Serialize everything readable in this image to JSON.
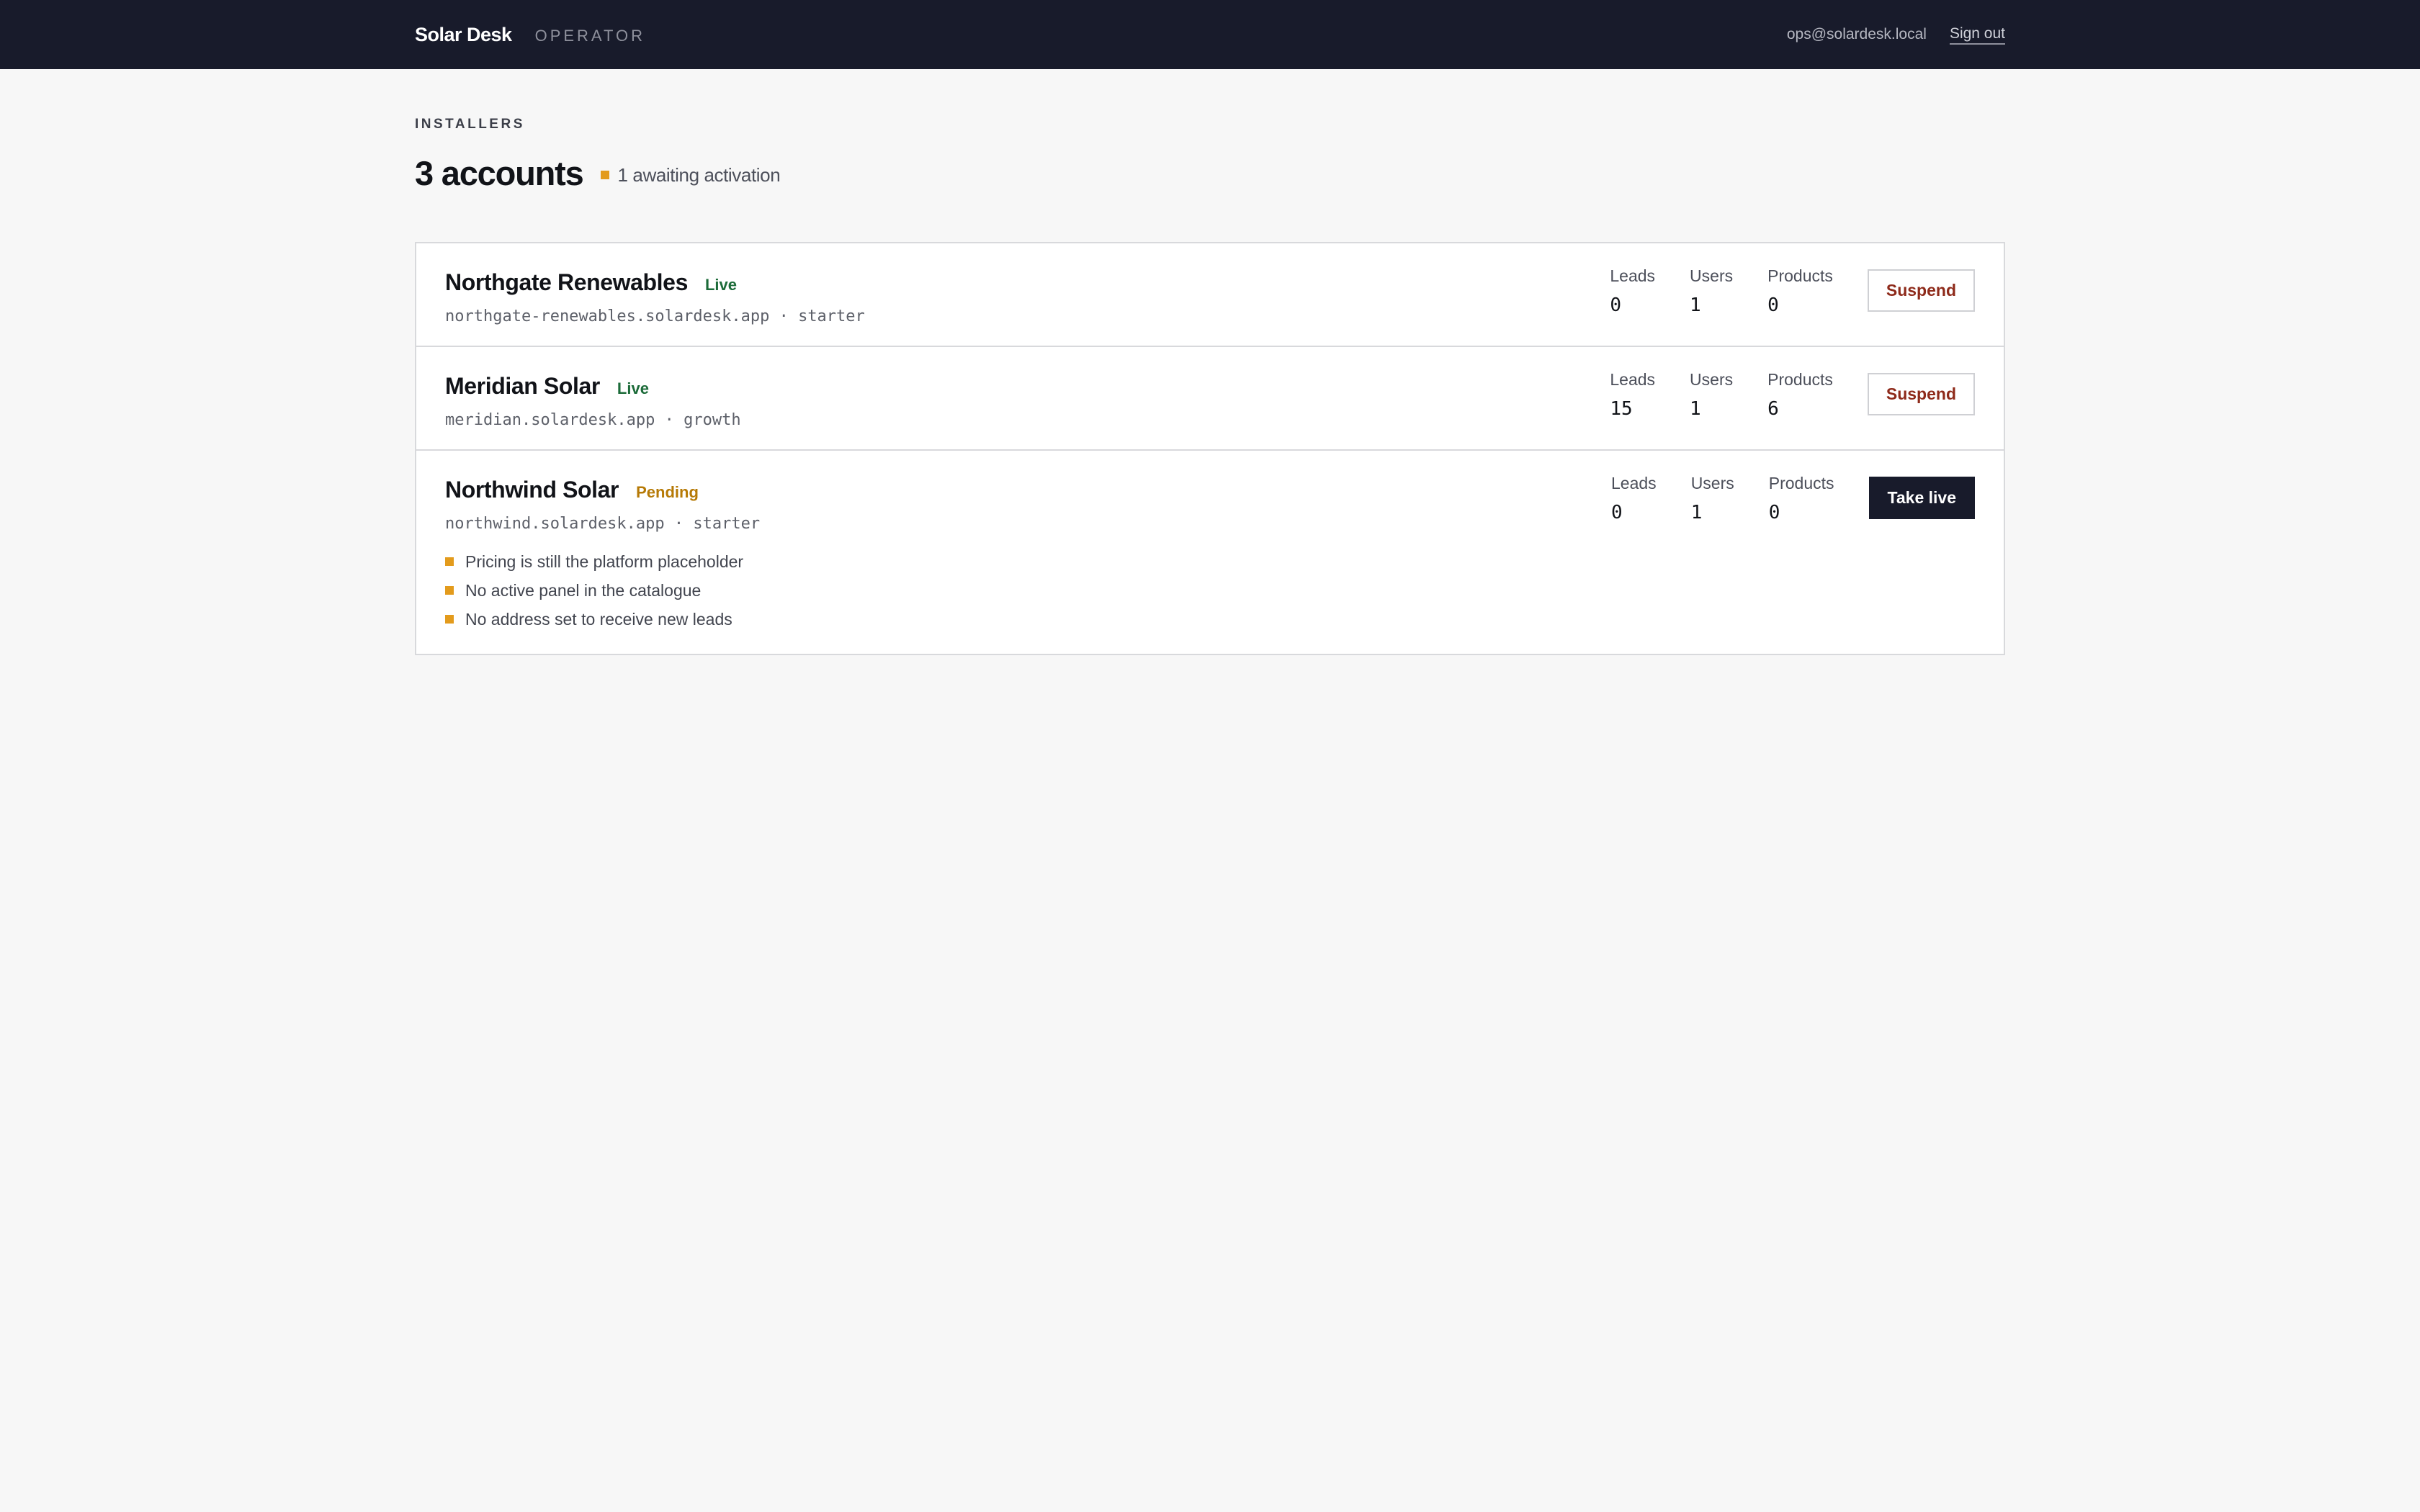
{
  "app": {
    "brand": "Solar Desk",
    "role": "OPERATOR",
    "user_email": "ops@solardesk.local",
    "sign_out_label": "Sign out"
  },
  "page": {
    "eyebrow": "INSTALLERS",
    "title": "3 accounts",
    "awaiting_text": "1 awaiting activation"
  },
  "colors": {
    "topbar": "#181b2b",
    "accent_warning": "#e39b1c",
    "status_live": "#1c6b39",
    "status_pending": "#b67a06",
    "suspend_text": "#8e2a1a"
  },
  "stat_labels": {
    "leads": "Leads",
    "users": "Users",
    "products": "Products"
  },
  "accounts": [
    {
      "name": "Northgate Renewables",
      "status": "Live",
      "subdomain_line": "northgate-renewables.solardesk.app · starter",
      "leads": "0",
      "users": "1",
      "products": "0",
      "action_label": "Suspend"
    },
    {
      "name": "Meridian Solar",
      "status": "Live",
      "subdomain_line": "meridian.solardesk.app · growth",
      "leads": "15",
      "users": "1",
      "products": "6",
      "action_label": "Suspend"
    },
    {
      "name": "Northwind Solar",
      "status": "Pending",
      "subdomain_line": "northwind.solardesk.app · starter",
      "leads": "0",
      "users": "1",
      "products": "0",
      "action_label": "Take live",
      "issues": [
        "Pricing is still the platform placeholder",
        "No active panel in the catalogue",
        "No address set to receive new leads"
      ]
    }
  ]
}
